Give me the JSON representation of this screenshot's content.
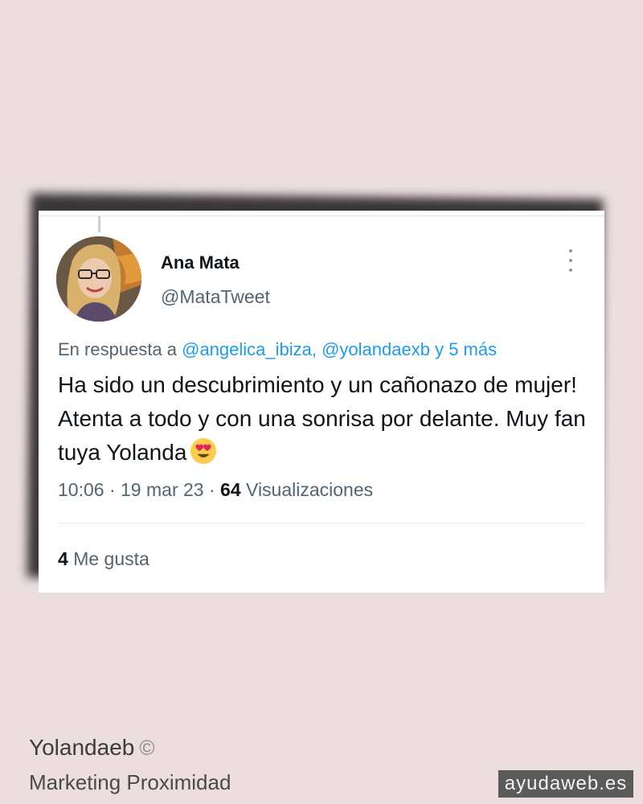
{
  "tweet": {
    "author_name": "Ana Mata",
    "author_handle": "@MataTweet",
    "reply_prefix": "En respuesta a",
    "reply_mentions": "@angelica_ibiza, @yolandaexb y 5 más",
    "body_text": "Ha sido un descubrimiento y un cañonazo de mujer! Atenta a todo y con una sonrisa por delante. Muy fan tuya Yolanda",
    "time": "10:06",
    "date": "19 mar 23",
    "views_count": "64",
    "views_label": "Visualizaciones",
    "likes_count": "4",
    "likes_label": "Me gusta",
    "icons": {
      "more": "more-options-icon",
      "emoji": "heart-eyes-emoji-icon"
    }
  },
  "footer": {
    "author": "Yolandaeb",
    "copyright_symbol": "©",
    "tagline": "Marketing Proximidad",
    "brand": "ayudaweb.es"
  },
  "colors": {
    "background": "#ecdedf",
    "link": "#1d9bf0",
    "secondary_text": "#536471",
    "brand_badge": "#5a5a5a"
  }
}
